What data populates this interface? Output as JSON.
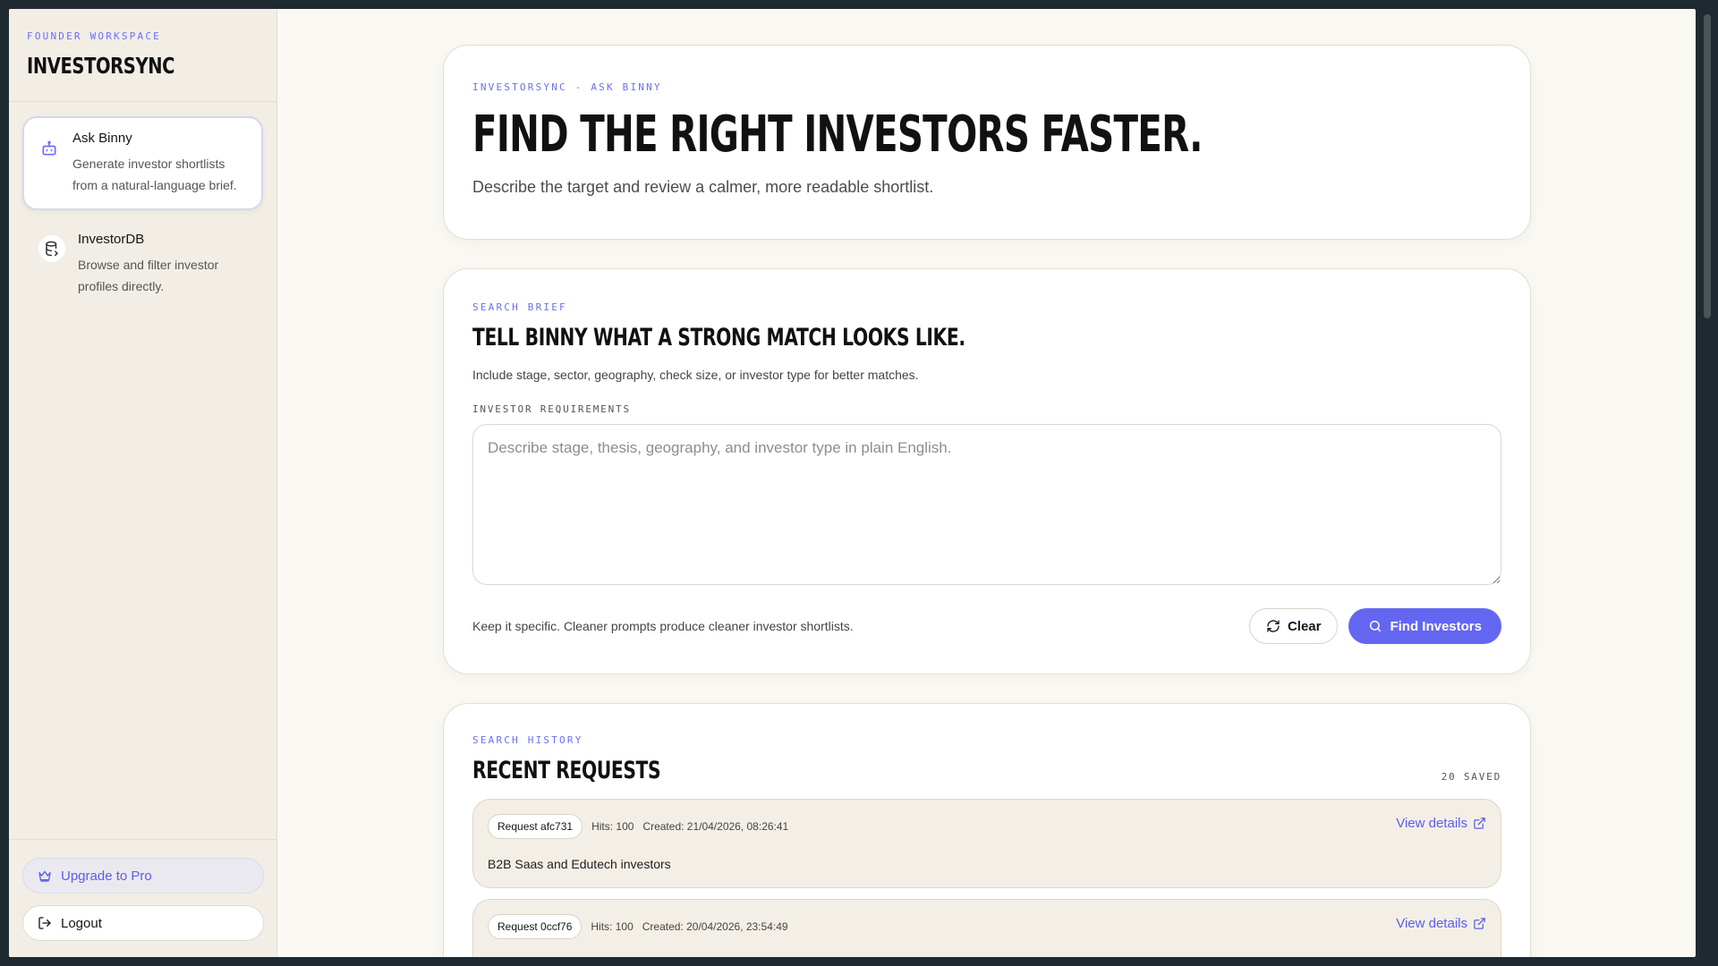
{
  "sidebar": {
    "eyebrow": "FOUNDER WORKSPACE",
    "brand": "INVESTORSYNC",
    "items": [
      {
        "title": "Ask Binny",
        "desc": "Generate investor shortlists from a natural-language brief.",
        "icon": "bot-icon"
      },
      {
        "title": "InvestorDB",
        "desc": "Browse and filter investor profiles directly.",
        "icon": "database-icon"
      }
    ],
    "upgrade": "Upgrade to Pro",
    "logout": "Logout"
  },
  "hero": {
    "eyebrow": "INVESTORSYNC - ASK BINNY",
    "title": "FIND THE RIGHT INVESTORS FASTER.",
    "subtitle": "Describe the target and review a calmer, more readable shortlist."
  },
  "brief": {
    "eyebrow": "SEARCH BRIEF",
    "title": "TELL BINNY WHAT A STRONG MATCH LOOKS LIKE.",
    "subtitle": "Include stage, sector, geography, check size, or investor type for better matches.",
    "field_label": "INVESTOR REQUIREMENTS",
    "placeholder": "Describe stage, thesis, geography, and investor type in plain English.",
    "hint": "Keep it specific. Cleaner prompts produce cleaner investor shortlists.",
    "clear_label": "Clear",
    "find_label": "Find Investors"
  },
  "history": {
    "eyebrow": "SEARCH HISTORY",
    "title": "RECENT REQUESTS",
    "saved": "20 SAVED",
    "requests": [
      {
        "id": "Request afc731",
        "hits": "Hits: 100",
        "created": "Created: 21/04/2026, 08:26:41",
        "query": "B2B Saas and Edutech investors",
        "link": "View details"
      },
      {
        "id": "Request 0ccf76",
        "hits": "Hits: 100",
        "created": "Created: 20/04/2026, 23:54:49",
        "query": "",
        "link": "View details"
      }
    ]
  },
  "colors": {
    "accent": "#6366f1",
    "background": "#faf8f3",
    "sidebar": "#f2eee6"
  }
}
